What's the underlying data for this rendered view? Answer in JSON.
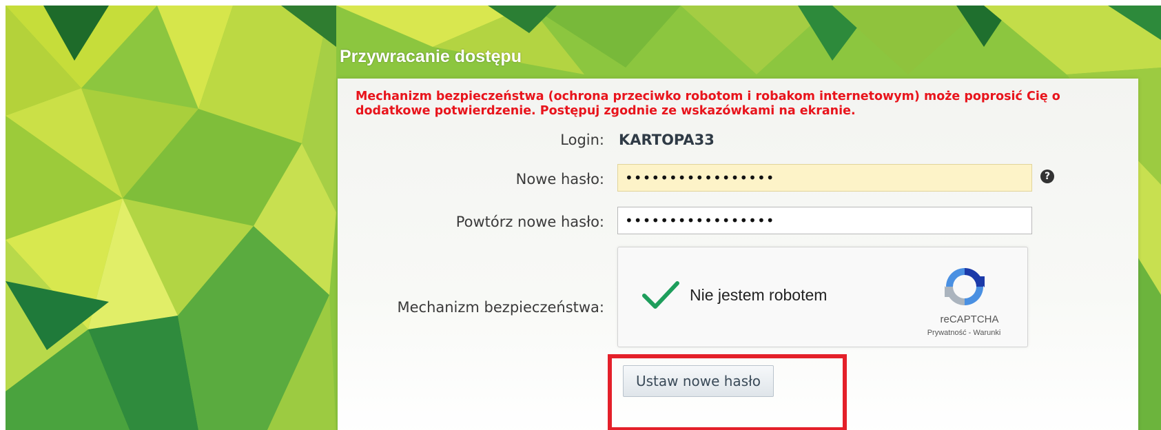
{
  "panel": {
    "title": "Przywracanie dostępu",
    "warning": "Mechanizm bezpieczeństwa (ochrona przeciwko robotom i robakom internetowym) może poprosić Cię o dodatkowe potwierdzenie. Postępuj zgodnie ze wskazówkami na ekranie."
  },
  "form": {
    "login_label": "Login:",
    "login_value": "KARTOPA33",
    "new_password_label": "Nowe hasło:",
    "new_password_value": "•••••••••••••••••",
    "repeat_password_label": "Powtórz nowe hasło:",
    "repeat_password_value": "•••••••••••••••••",
    "security_label": "Mechanizm bezpieczeństwa:",
    "help_icon": "question-circle-icon"
  },
  "captcha": {
    "checkbox_text": "Nie jestem robotem",
    "brand": "reCAPTCHA",
    "links": "Prywatność - Warunki",
    "check_color": "#1e9e5c"
  },
  "submit": {
    "label": "Ustaw nowe hasło"
  },
  "colors": {
    "warning": "#e8141c",
    "highlight_box": "#e4202a",
    "field_highlight": "#fdf3c8"
  }
}
